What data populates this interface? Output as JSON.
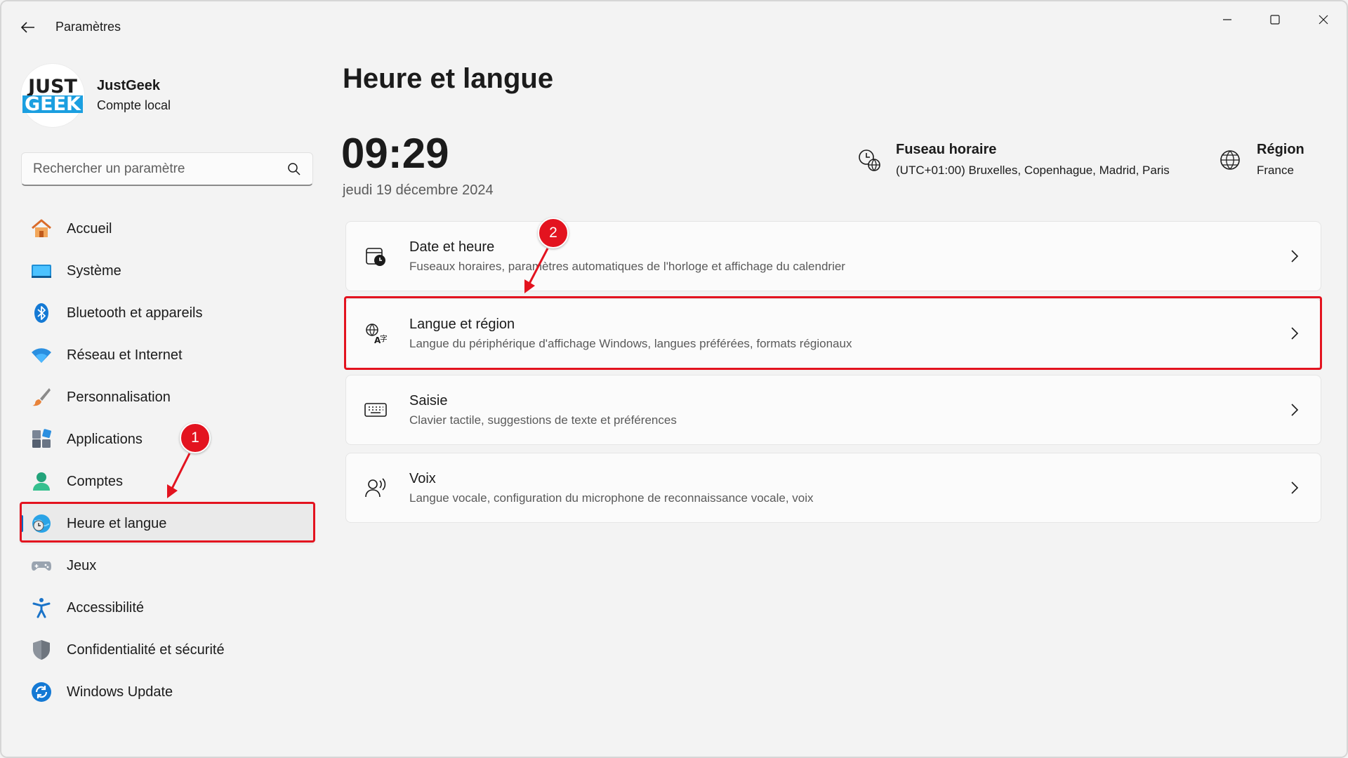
{
  "window": {
    "title": "Paramètres",
    "minimize_symbol": "─",
    "maximize_symbol": "☐",
    "close_symbol": "✕"
  },
  "profile": {
    "logo_line1": "JUST",
    "logo_line2": "GEEK",
    "name": "JustGeek",
    "account_type": "Compte local"
  },
  "search": {
    "placeholder": "Rechercher un paramètre",
    "icon": "search-icon"
  },
  "sidebar": {
    "items": [
      {
        "label": "Accueil",
        "icon": "home-icon"
      },
      {
        "label": "Système",
        "icon": "system-icon"
      },
      {
        "label": "Bluetooth et appareils",
        "icon": "bluetooth-icon"
      },
      {
        "label": "Réseau et Internet",
        "icon": "wifi-icon"
      },
      {
        "label": "Personnalisation",
        "icon": "brush-icon"
      },
      {
        "label": "Applications",
        "icon": "apps-icon"
      },
      {
        "label": "Comptes",
        "icon": "person-icon"
      },
      {
        "label": "Heure et langue",
        "icon": "time-language-icon",
        "active": true
      },
      {
        "label": "Jeux",
        "icon": "gamepad-icon"
      },
      {
        "label": "Accessibilité",
        "icon": "accessibility-icon"
      },
      {
        "label": "Confidentialité et sécurité",
        "icon": "shield-icon"
      },
      {
        "label": "Windows Update",
        "icon": "update-icon"
      }
    ]
  },
  "main": {
    "title": "Heure et langue",
    "time": "09:29",
    "date": "jeudi 19 décembre 2024",
    "timezone": {
      "title": "Fuseau horaire",
      "value": "(UTC+01:00) Bruxelles, Copenhague, Madrid, Paris"
    },
    "region": {
      "title": "Région",
      "value": "France"
    },
    "cards": [
      {
        "title": "Date et heure",
        "subtitle": "Fuseaux horaires, paramètres automatiques de l'horloge et affichage du calendrier",
        "icon": "calendar-clock-icon"
      },
      {
        "title": "Langue et région",
        "subtitle": "Langue du périphérique d'affichage Windows, langues préférées, formats régionaux",
        "icon": "language-icon"
      },
      {
        "title": "Saisie",
        "subtitle": "Clavier tactile, suggestions de texte et préférences",
        "icon": "keyboard-icon"
      },
      {
        "title": "Voix",
        "subtitle": "Langue vocale, configuration du microphone de reconnaissance vocale, voix",
        "icon": "speech-icon"
      }
    ]
  },
  "annotations": {
    "badge1": "1",
    "badge2": "2",
    "color": "#e3131f"
  },
  "colors": {
    "accent": "#0067c0",
    "background": "#f3f3f3",
    "card": "#fbfbfb"
  }
}
